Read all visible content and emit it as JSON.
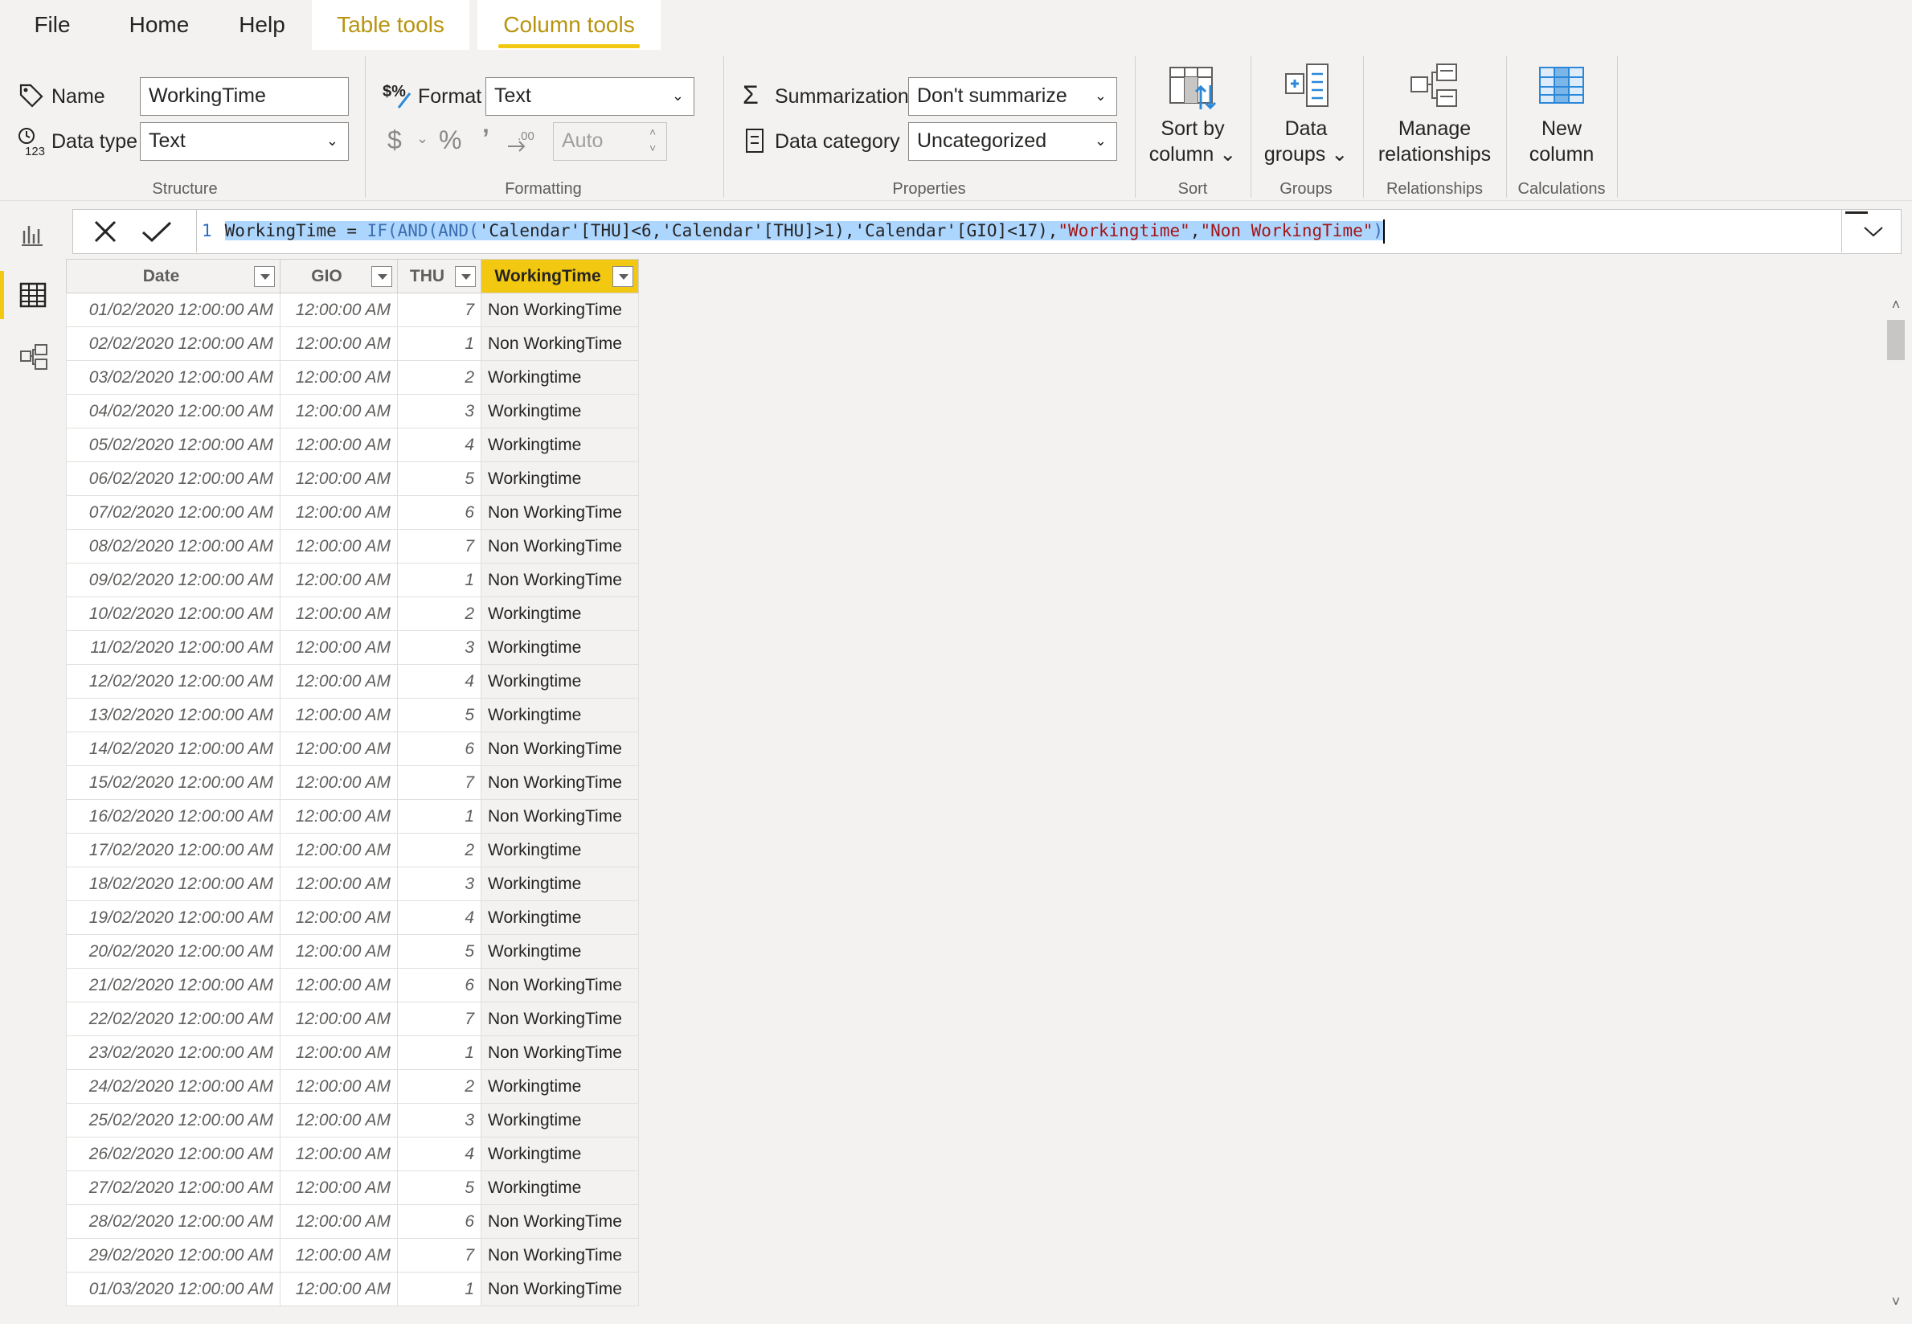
{
  "tabs": {
    "file": "File",
    "home": "Home",
    "help": "Help",
    "table_tools": "Table tools",
    "column_tools": "Column tools"
  },
  "ribbon": {
    "structure": {
      "group_label": "Structure",
      "name_label": "Name",
      "name_value": "WorkingTime",
      "datatype_label": "Data type",
      "datatype_value": "Text"
    },
    "formatting": {
      "group_label": "Formatting",
      "format_label": "Format",
      "format_value": "Text",
      "decimal_placeholder": "Auto"
    },
    "properties": {
      "group_label": "Properties",
      "summarization_label": "Summarization",
      "summarization_value": "Don't summarize",
      "category_label": "Data category",
      "category_value": "Uncategorized"
    },
    "sort": {
      "group_label": "Sort",
      "btn_line1": "Sort by",
      "btn_line2": "column"
    },
    "groups": {
      "group_label": "Groups",
      "btn_line1": "Data",
      "btn_line2": "groups"
    },
    "relationships": {
      "group_label": "Relationships",
      "btn_line1": "Manage",
      "btn_line2": "relationships"
    },
    "calculations": {
      "group_label": "Calculations",
      "btn_line1": "New",
      "btn_line2": "column"
    }
  },
  "formula": {
    "line_number": "1",
    "tokens": {
      "t1": "WorkingTime = ",
      "t2": "IF(AND(AND(",
      "t3": "'Calendar'[THU]<6,'Calendar'[THU]>1),'Calendar'[GIO]<17),",
      "t4": "\"Workingtime\"",
      "t5": ",",
      "t6": "\"Non WorkingTime\"",
      "t7": ")"
    }
  },
  "grid": {
    "headers": [
      "Date",
      "GIO",
      "THU",
      "WorkingTime"
    ],
    "rows": [
      [
        "01/02/2020 12:00:00 AM",
        "12:00:00 AM",
        "7",
        "Non WorkingTime"
      ],
      [
        "02/02/2020 12:00:00 AM",
        "12:00:00 AM",
        "1",
        "Non WorkingTime"
      ],
      [
        "03/02/2020 12:00:00 AM",
        "12:00:00 AM",
        "2",
        "Workingtime"
      ],
      [
        "04/02/2020 12:00:00 AM",
        "12:00:00 AM",
        "3",
        "Workingtime"
      ],
      [
        "05/02/2020 12:00:00 AM",
        "12:00:00 AM",
        "4",
        "Workingtime"
      ],
      [
        "06/02/2020 12:00:00 AM",
        "12:00:00 AM",
        "5",
        "Workingtime"
      ],
      [
        "07/02/2020 12:00:00 AM",
        "12:00:00 AM",
        "6",
        "Non WorkingTime"
      ],
      [
        "08/02/2020 12:00:00 AM",
        "12:00:00 AM",
        "7",
        "Non WorkingTime"
      ],
      [
        "09/02/2020 12:00:00 AM",
        "12:00:00 AM",
        "1",
        "Non WorkingTime"
      ],
      [
        "10/02/2020 12:00:00 AM",
        "12:00:00 AM",
        "2",
        "Workingtime"
      ],
      [
        "11/02/2020 12:00:00 AM",
        "12:00:00 AM",
        "3",
        "Workingtime"
      ],
      [
        "12/02/2020 12:00:00 AM",
        "12:00:00 AM",
        "4",
        "Workingtime"
      ],
      [
        "13/02/2020 12:00:00 AM",
        "12:00:00 AM",
        "5",
        "Workingtime"
      ],
      [
        "14/02/2020 12:00:00 AM",
        "12:00:00 AM",
        "6",
        "Non WorkingTime"
      ],
      [
        "15/02/2020 12:00:00 AM",
        "12:00:00 AM",
        "7",
        "Non WorkingTime"
      ],
      [
        "16/02/2020 12:00:00 AM",
        "12:00:00 AM",
        "1",
        "Non WorkingTime"
      ],
      [
        "17/02/2020 12:00:00 AM",
        "12:00:00 AM",
        "2",
        "Workingtime"
      ],
      [
        "18/02/2020 12:00:00 AM",
        "12:00:00 AM",
        "3",
        "Workingtime"
      ],
      [
        "19/02/2020 12:00:00 AM",
        "12:00:00 AM",
        "4",
        "Workingtime"
      ],
      [
        "20/02/2020 12:00:00 AM",
        "12:00:00 AM",
        "5",
        "Workingtime"
      ],
      [
        "21/02/2020 12:00:00 AM",
        "12:00:00 AM",
        "6",
        "Non WorkingTime"
      ],
      [
        "22/02/2020 12:00:00 AM",
        "12:00:00 AM",
        "7",
        "Non WorkingTime"
      ],
      [
        "23/02/2020 12:00:00 AM",
        "12:00:00 AM",
        "1",
        "Non WorkingTime"
      ],
      [
        "24/02/2020 12:00:00 AM",
        "12:00:00 AM",
        "2",
        "Workingtime"
      ],
      [
        "25/02/2020 12:00:00 AM",
        "12:00:00 AM",
        "3",
        "Workingtime"
      ],
      [
        "26/02/2020 12:00:00 AM",
        "12:00:00 AM",
        "4",
        "Workingtime"
      ],
      [
        "27/02/2020 12:00:00 AM",
        "12:00:00 AM",
        "5",
        "Workingtime"
      ],
      [
        "28/02/2020 12:00:00 AM",
        "12:00:00 AM",
        "6",
        "Non WorkingTime"
      ],
      [
        "29/02/2020 12:00:00 AM",
        "12:00:00 AM",
        "7",
        "Non WorkingTime"
      ],
      [
        "01/03/2020 12:00:00 AM",
        "12:00:00 AM",
        "1",
        "Non WorkingTime"
      ]
    ]
  },
  "rail": {
    "items": [
      "report-view-icon",
      "data-view-icon",
      "model-view-icon"
    ]
  },
  "colors": {
    "accent": "#f2c811",
    "context_tab_text": "#b8930e",
    "selection": "#add6ff",
    "dax_function": "#3c6fb0",
    "dax_string": "#a31515"
  }
}
